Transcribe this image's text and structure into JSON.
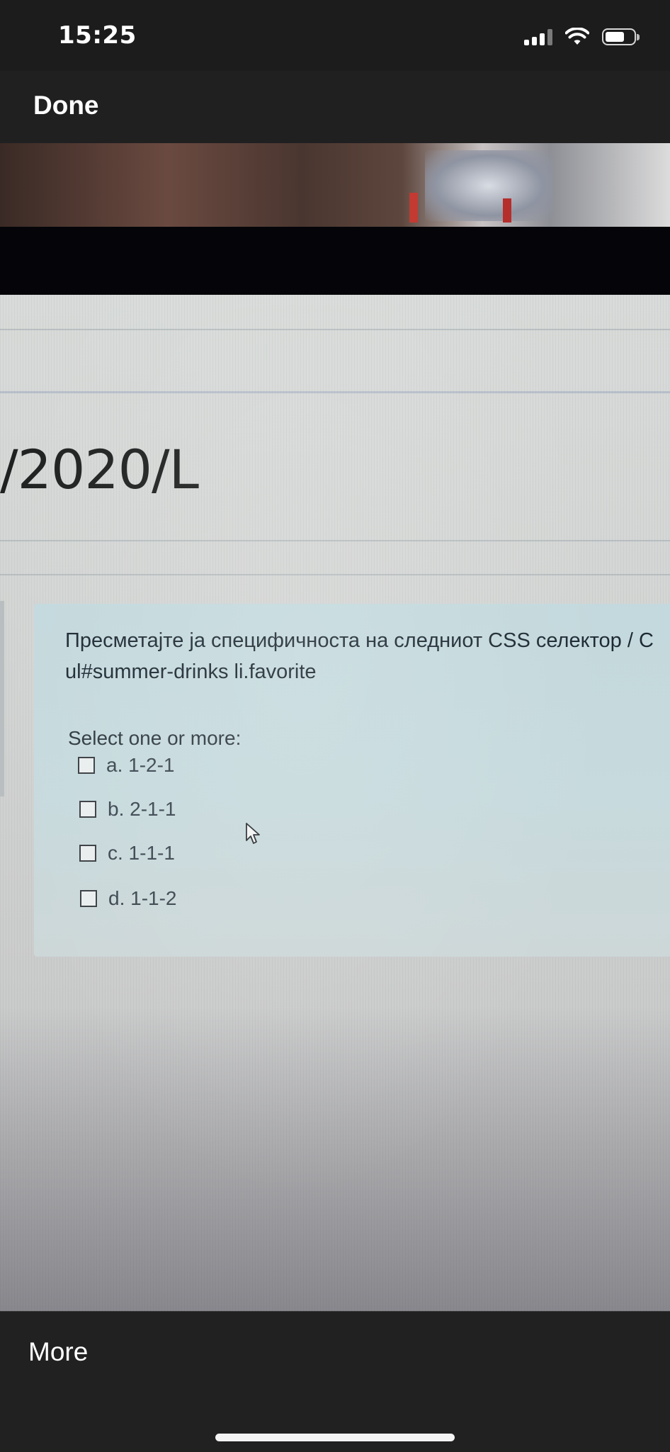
{
  "status_bar": {
    "time": "15:25"
  },
  "nav": {
    "done_label": "Done"
  },
  "screen": {
    "page_title": "/2020/L",
    "question": {
      "line1": "Пресметајте ја специфичноста на следниот CSS селектор / С",
      "line2": "ul#summer-drinks li.favorite",
      "prompt": "Select one or more:",
      "options": [
        {
          "label": "a. 1-2-1"
        },
        {
          "label": "b. 2-1-1"
        },
        {
          "label": "c. 1-1-1"
        },
        {
          "label": "d. 1-1-2"
        }
      ]
    }
  },
  "toolbar": {
    "more_label": "More"
  },
  "icons": {
    "signal": "cellular-signal-icon",
    "wifi": "wifi-icon",
    "battery": "battery-icon",
    "cursor": "mouse-pointer-icon"
  }
}
